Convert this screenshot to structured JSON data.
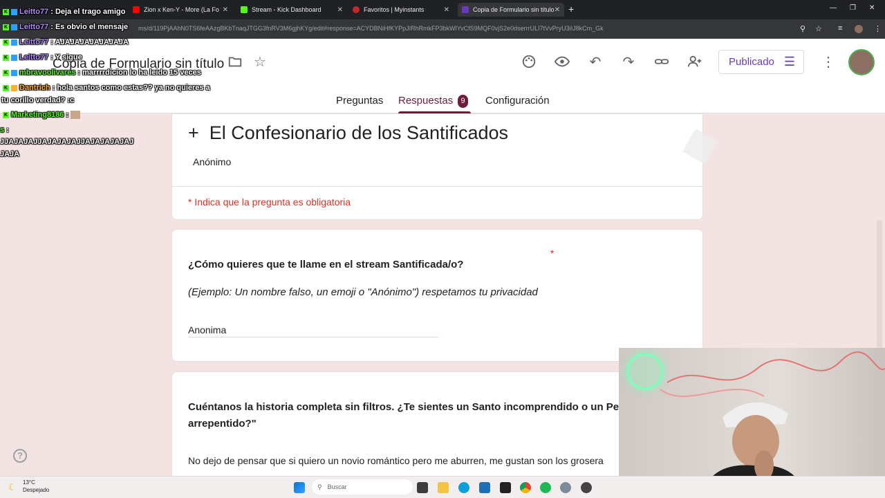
{
  "browser": {
    "tabs": [
      {
        "label": "Zion x Ken-Y - More (La Fo",
        "color": "#ff0000"
      },
      {
        "label": "Stream - Kick Dashboard",
        "color": "#53fc18"
      },
      {
        "label": "Favoritos | Myinstants",
        "color": "#c62828"
      },
      {
        "label": "Copia de Formulario sin título",
        "color": "#673ab7"
      }
    ],
    "url": "ms/d/119PjAAhN0TS6feAAzgBKbTnaqJTGG3fnRV3M6gjhKYg/edit#response=ACYDBNiHfKYPpJIRhRmkFP3bkWlYvCfS9MQF0vjS2e0dserrrULI7tVvPryU3iIJ8kCm_Gk"
  },
  "header": {
    "form_title": "Copia de Formulario sin título",
    "publish_label": "Publicado",
    "tabs": {
      "questions": "Preguntas",
      "responses": "Respuestas",
      "responses_count": "9",
      "settings": "Configuración"
    }
  },
  "form": {
    "plus": "+",
    "title": "El Confesionario de los Santificados",
    "subtitle": "Anónimo",
    "required_note": "* Indica que la pregunta es obligatoria",
    "q1": {
      "title": "¿Cómo quieres que te llame en el stream Santificada/o?",
      "required": "*",
      "help": "(Ejemplo: Un nombre falso, un emoji o \"Anónimo\") respetamos tu privacidad",
      "answer": "Anonima"
    },
    "q2": {
      "title_line1": "Cuéntanos la historia completa sin filtros. ¿Te sientes un Santo incomprendido o un Pe",
      "title_line2": "arrepentido?\"",
      "answer": "No dejo de pensar que si quiero un novio romántico  pero me aburren, me gustan son los grosera"
    }
  },
  "chat": [
    {
      "user": "Leitto77",
      "msg": "Deja el trago amigo",
      "color": "#b58cff"
    },
    {
      "user": "Leitto77",
      "msg": "Es obvio el mensaje",
      "color": "#b58cff"
    },
    {
      "user": "Leitto77",
      "msg": "AJAJAJAJAJAJAJA",
      "color": "#b58cff"
    },
    {
      "user": "Leitto77",
      "msg": "Y sigue",
      "color": "#b58cff"
    },
    {
      "user": "mbravoolivares",
      "msg": "marrrrdicion lo ha leido 15 veces",
      "color": "#53fc18"
    },
    {
      "user": "Dantrich",
      "msg": "hola santos como estas?? ya no quieres a",
      "color": "#ffb02e"
    },
    {
      "user": "",
      "msg": "tu corillo verdad? :c",
      "color": "#ffffff"
    },
    {
      "user": "Marketing8186",
      "msg": "",
      "color": "#53fc18"
    },
    {
      "user": "s",
      "msg": "",
      "color": "#53fc18"
    },
    {
      "user": "",
      "msg": "JJAJAJAJJAJAJAJAJJAJAJAJAJAJ",
      "color": "#ffffff"
    },
    {
      "user": "",
      "msg": "JAJA",
      "color": "#ffffff"
    }
  ],
  "taskbar": {
    "temp": "13°C",
    "weather": "Despejado",
    "search_placeholder": "Buscar"
  },
  "help": "?"
}
